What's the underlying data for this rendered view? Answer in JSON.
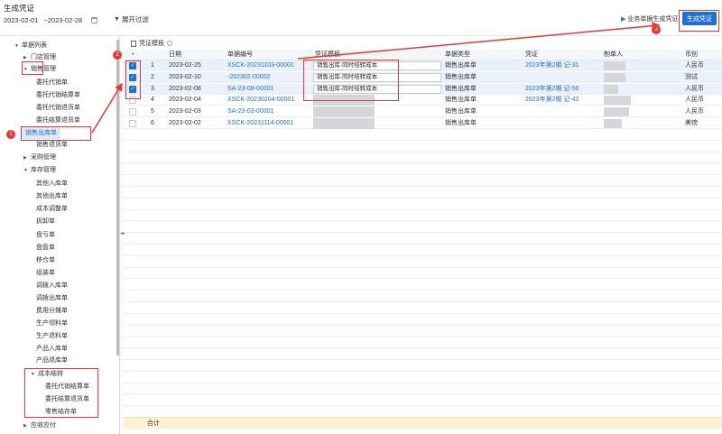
{
  "page": {
    "title": "生成凭证",
    "date_from": "2023-02-01",
    "date_to": "~2023-02-28",
    "filter_label": "展开过滤",
    "biz_link_label": "业务单据生成凭证",
    "generate_button": "生成凭证"
  },
  "sidebar": {
    "items": [
      {
        "label": "单据列表",
        "caret": "▼"
      },
      {
        "label": "门店管理",
        "caret": "▶"
      },
      {
        "label": "销售管理",
        "caret": "▼"
      },
      {
        "label": "委托代销单",
        "caret": ""
      },
      {
        "label": "委托代销结算单",
        "caret": ""
      },
      {
        "label": "委托代销退货单",
        "caret": ""
      },
      {
        "label": "委托结算退货单",
        "caret": ""
      },
      {
        "label": "销售出库单",
        "caret": ""
      },
      {
        "label": "销售退货单",
        "caret": ""
      },
      {
        "label": "采购管理",
        "caret": "▶"
      },
      {
        "label": "库存管理",
        "caret": "▼"
      },
      {
        "label": "其他入库单",
        "caret": ""
      },
      {
        "label": "其他出库单",
        "caret": ""
      },
      {
        "label": "成本调整单",
        "caret": ""
      },
      {
        "label": "拆卸单",
        "caret": ""
      },
      {
        "label": "盘亏单",
        "caret": ""
      },
      {
        "label": "盘盈单",
        "caret": ""
      },
      {
        "label": "移仓单",
        "caret": ""
      },
      {
        "label": "组装单",
        "caret": ""
      },
      {
        "label": "调拨入库单",
        "caret": ""
      },
      {
        "label": "调拨出库单",
        "caret": ""
      },
      {
        "label": "费用分摊单",
        "caret": ""
      },
      {
        "label": "生产领料单",
        "caret": ""
      },
      {
        "label": "生产退料单",
        "caret": ""
      },
      {
        "label": "产品入库单",
        "caret": ""
      },
      {
        "label": "产品退库单",
        "caret": ""
      },
      {
        "label": "成本结转",
        "caret": "▼"
      },
      {
        "label": "委托代销结算单",
        "caret": ""
      },
      {
        "label": "委托结算退货单",
        "caret": ""
      },
      {
        "label": "零售结存单",
        "caret": ""
      },
      {
        "label": "应收应付",
        "caret": "▶"
      }
    ]
  },
  "main": {
    "tab_label": "凭证模板",
    "columns": [
      "日期",
      "单据编号",
      "凭证模板",
      "单据类型",
      "凭证",
      "制单人",
      "币别"
    ],
    "rows": [
      {
        "no": "1",
        "checked": true,
        "date": "2023-02-25",
        "code": "XSCK-20231103-00001",
        "template": "销售出库-同时结转成本",
        "type": "销售出库单",
        "voucher": "2023年第2期 记-31",
        "currency": "人民币"
      },
      {
        "no": "2",
        "checked": true,
        "date": "2023-02-10",
        "code": "-202302-00002",
        "template": "销售出库-同时结转成本",
        "type": "销售出库单",
        "voucher": "",
        "currency": "测试"
      },
      {
        "no": "3",
        "checked": true,
        "date": "2023-02-08",
        "code": "SA-23-08-00001",
        "template": "销售出库-同时结转成本",
        "type": "销售出库单",
        "voucher": "2023年第2期 记-50",
        "currency": "人民币"
      },
      {
        "no": "4",
        "checked": false,
        "date": "2023-02-04",
        "code": "XSCK-20230204-00001",
        "template": "",
        "type": "销售出库单",
        "voucher": "2023年第2期 记-42",
        "currency": "人民币"
      },
      {
        "no": "5",
        "checked": false,
        "date": "2023-02-03",
        "code": "SA-23-03-00001",
        "template": "",
        "type": "销售出库单",
        "voucher": "",
        "currency": "人民币"
      },
      {
        "no": "6",
        "checked": false,
        "date": "2023-02-02",
        "code": "XSCK-20231114-00001",
        "template": "",
        "type": "销售出库单",
        "voucher": "",
        "currency": "美镑"
      }
    ],
    "total_label": "合计"
  },
  "annotations": [
    "1",
    "2",
    "3"
  ],
  "colors": {
    "accent": "#1e6fd9",
    "annotation": "#e53935",
    "selected": "#dde9fb",
    "total_bar": "#fdf3d4"
  }
}
